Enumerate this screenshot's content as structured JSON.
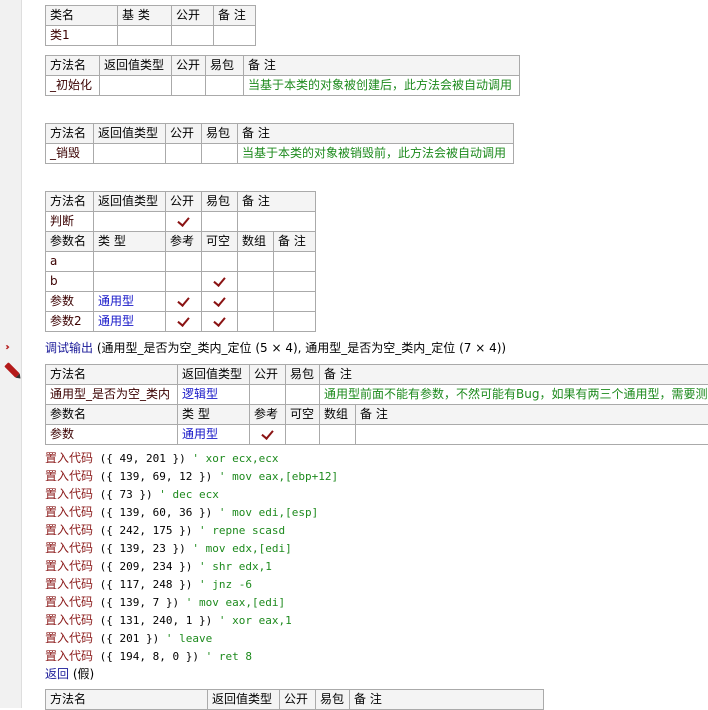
{
  "class_table": {
    "headers": [
      "类名",
      "基 类",
      "公开",
      "备 注"
    ],
    "row": [
      "类1",
      "",
      "",
      ""
    ]
  },
  "method_init": {
    "headers": [
      "方法名",
      "返回值类型",
      "公开",
      "易包",
      "备 注"
    ],
    "row": [
      "_初始化",
      "",
      "",
      "",
      "当基于本类的对象被创建后，此方法会被自动调用"
    ]
  },
  "method_destroy": {
    "headers": [
      "方法名",
      "返回值类型",
      "公开",
      "易包",
      "备 注"
    ],
    "row": [
      "_销毁",
      "",
      "",
      "",
      "当基于本类的对象被销毁前，此方法会被自动调用"
    ]
  },
  "method_judge": {
    "headers": [
      "方法名",
      "返回值类型",
      "公开",
      "易包",
      "备 注"
    ],
    "row": [
      "判断",
      "",
      "✓",
      "",
      ""
    ],
    "param_headers": [
      "参数名",
      "类 型",
      "参考",
      "可空",
      "数组",
      "备 注"
    ],
    "params": [
      [
        "a",
        "",
        "",
        "",
        "",
        ""
      ],
      [
        "b",
        "",
        "",
        "✓",
        "",
        ""
      ],
      [
        "参数",
        "通用型",
        "✓",
        "✓",
        "",
        ""
      ],
      [
        "参数2",
        "通用型",
        "✓",
        "✓",
        "",
        ""
      ]
    ]
  },
  "debug_line": {
    "keyword": "调试输出",
    "args": " (通用型_是否为空_类内_定位 (5 × 4), 通用型_是否为空_类内_定位 (7 × 4))"
  },
  "method_isnull": {
    "headers": [
      "方法名",
      "返回值类型",
      "公开",
      "易包",
      "备 注"
    ],
    "row": [
      "通用型_是否为空_类内",
      "逻辑型",
      "",
      "",
      "通用型前面不能有参数，不然可能有Bug，如果有两三个通用型，需要测试"
    ],
    "param_headers": [
      "参数名",
      "类 型",
      "参考",
      "可空",
      "数组",
      "备 注"
    ],
    "params": [
      [
        "参数",
        "通用型",
        "✓",
        "",
        "",
        ""
      ]
    ]
  },
  "code_lines": [
    {
      "kw": "置入代码",
      "args": " ({ 49, 201 }) ",
      "cmt": " ' xor ecx,ecx"
    },
    {
      "kw": "置入代码",
      "args": " ({ 139, 69, 12 }) ",
      "cmt": " ' mov eax,[ebp+12]"
    },
    {
      "kw": "置入代码",
      "args": " ({ 73 }) ",
      "cmt": " ' dec ecx"
    },
    {
      "kw": "置入代码",
      "args": " ({ 139, 60, 36 }) ",
      "cmt": " ' mov edi,[esp]"
    },
    {
      "kw": "置入代码",
      "args": " ({ 242, 175 }) ",
      "cmt": " ' repne scasd"
    },
    {
      "kw": "置入代码",
      "args": " ({ 139, 23 }) ",
      "cmt": " ' mov edx,[edi]"
    },
    {
      "kw": "置入代码",
      "args": " ({ 209, 234 }) ",
      "cmt": " ' shr edx,1"
    },
    {
      "kw": "置入代码",
      "args": " ({ 117, 248 }) ",
      "cmt": " ' jnz -6"
    },
    {
      "kw": "置入代码",
      "args": " ({ 139, 7 }) ",
      "cmt": " ' mov eax,[edi]"
    },
    {
      "kw": "置入代码",
      "args": " ({ 131, 240, 1 }) ",
      "cmt": " ' xor eax,1"
    },
    {
      "kw": "置入代码",
      "args": " ({ 201 }) ",
      "cmt": " ' leave"
    },
    {
      "kw": "置入代码",
      "args": " ({ 194, 8, 0 }) ",
      "cmt": " ' ret 8"
    }
  ],
  "return_line": {
    "kw": "返回",
    "args": " (假)"
  },
  "method_next": {
    "headers": [
      "方法名",
      "返回值类型",
      "公开",
      "易包",
      "备 注"
    ]
  },
  "colors": {
    "comment_green": "#1d8a1d",
    "type_blue": "#1717c8",
    "keyword_red": "#8b1a1a",
    "checkmark": "#8b1414"
  },
  "icons": [
    "arrow-icon",
    "pencil-icon",
    "check-icon"
  ]
}
